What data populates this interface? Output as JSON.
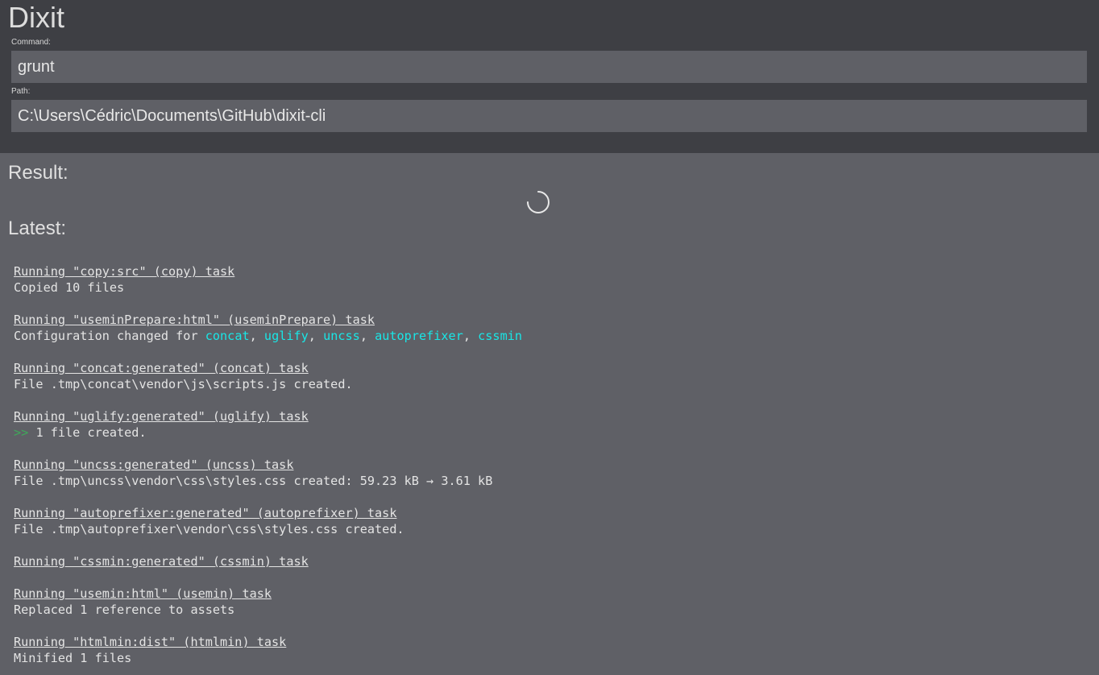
{
  "app": {
    "title": "Dixit"
  },
  "command": {
    "label": "Command:",
    "value": "grunt"
  },
  "path": {
    "label": "Path:",
    "value": "C:\\Users\\Cédric\\Documents\\GitHub\\dixit-cli"
  },
  "result": {
    "title": "Result:",
    "spinner_icon": "loading-spinner-icon"
  },
  "latest": {
    "title": "Latest:",
    "log": {
      "task1": "Running \"copy:src\" (copy) task",
      "out1": "Copied 10 files",
      "task2": "Running \"useminPrepare:html\" (useminPrepare) task",
      "out2_prefix": "Configuration changed for ",
      "out2_items": [
        "concat",
        "uglify",
        "uncss",
        "autoprefixer",
        "cssmin"
      ],
      "out2_sep": ", ",
      "task3": "Running \"concat:generated\" (concat) task",
      "out3": "File .tmp\\concat\\vendor\\js\\scripts.js created.",
      "task4": "Running \"uglify:generated\" (uglify) task",
      "out4_marker": ">>",
      "out4_text": " 1 file created.",
      "task5": "Running \"uncss:generated\" (uncss) task",
      "out5": "File .tmp\\uncss\\vendor\\css\\styles.css created: 59.23 kB → 3.61 kB",
      "task6": "Running \"autoprefixer:generated\" (autoprefixer) task",
      "out6": "File .tmp\\autoprefixer\\vendor\\css\\styles.css created.",
      "task7": "Running \"cssmin:generated\" (cssmin) task",
      "task8": "Running \"usemin:html\" (usemin) task",
      "out8": "Replaced 1 reference to assets",
      "task9": "Running \"htmlmin:dist\" (htmlmin) task",
      "out9": "Minified 1 files"
    }
  },
  "colors": {
    "header_bg": "#3e3f44",
    "body_bg": "#5f6066",
    "highlight": "#19e6e6",
    "marker": "#3fa85a"
  }
}
